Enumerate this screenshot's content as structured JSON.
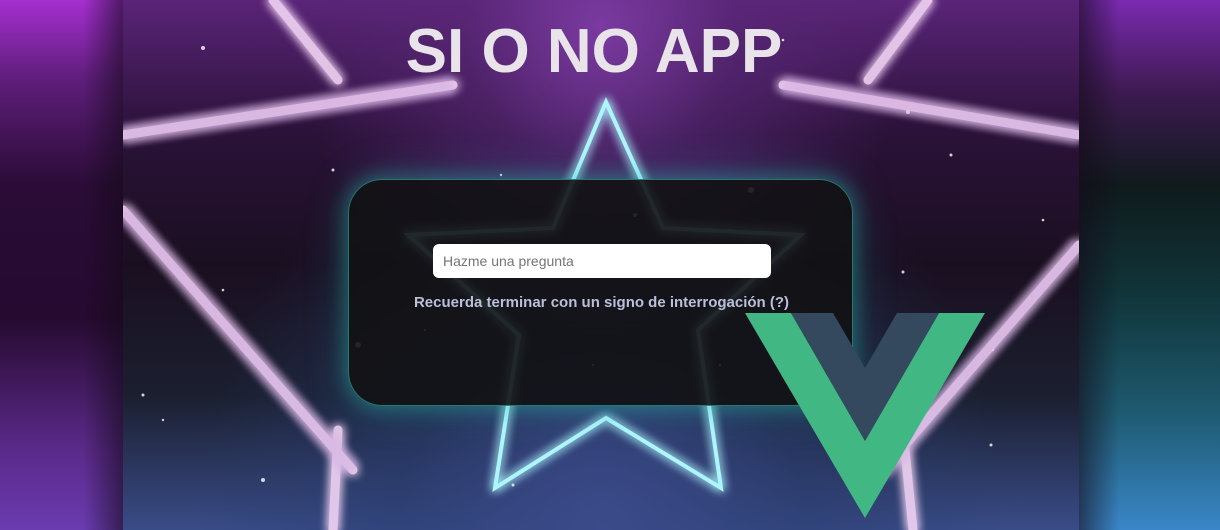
{
  "app": {
    "title": "SI O NO APP"
  },
  "form": {
    "question_placeholder": "Hazme una pregunta",
    "question_value": "",
    "hint": "Recuerda terminar con un signo de interrogación (?)"
  },
  "logo": {
    "icon": "vue-logo-icon",
    "colors": {
      "outer": "#41b883",
      "inner": "#34495e"
    }
  },
  "theme": {
    "neon_cyan": "#7fe6f0",
    "neon_pink": "#f2c8f0",
    "card_glow": "#2ec8b4"
  }
}
